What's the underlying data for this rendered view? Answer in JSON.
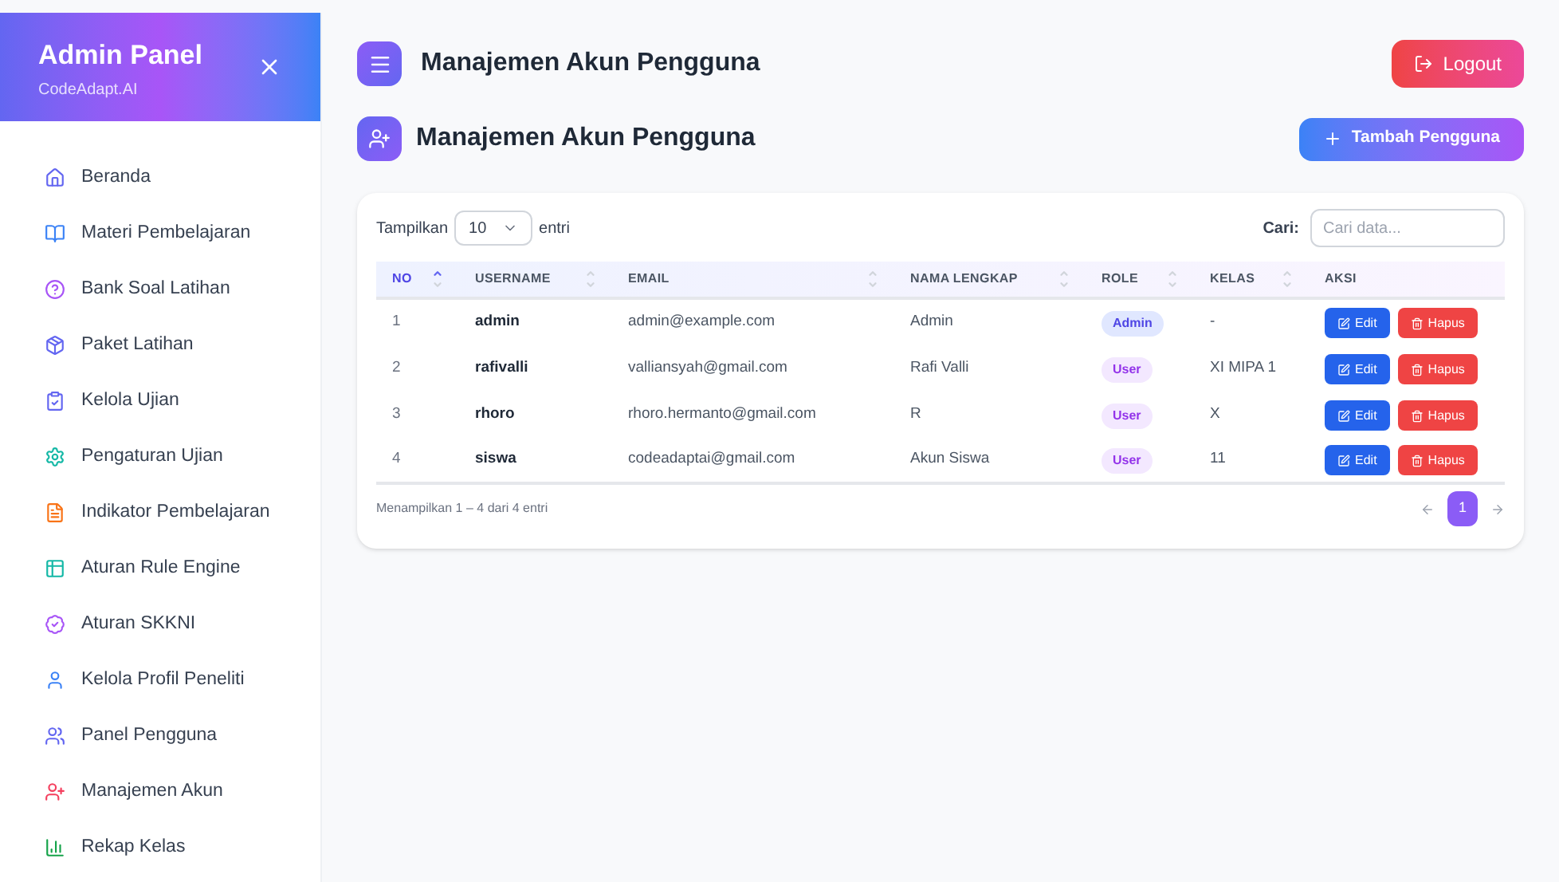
{
  "sidebar": {
    "title": "Admin Panel",
    "subtitle": "CodeAdapt.AI",
    "items": [
      {
        "label": "Beranda",
        "color": "#6366f1"
      },
      {
        "label": "Materi Pembelajaran",
        "color": "#3b82f6"
      },
      {
        "label": "Bank Soal Latihan",
        "color": "#a855f7"
      },
      {
        "label": "Paket Latihan",
        "color": "#6366f1"
      },
      {
        "label": "Kelola Ujian",
        "color": "#6366f1"
      },
      {
        "label": "Pengaturan Ujian",
        "color": "#14b8a6"
      },
      {
        "label": "Indikator Pembelajaran",
        "color": "#f97316"
      },
      {
        "label": "Aturan Rule Engine",
        "color": "#14b8a6"
      },
      {
        "label": "Aturan SKKNI",
        "color": "#a855f7"
      },
      {
        "label": "Kelola Profil Peneliti",
        "color": "#3b82f6"
      },
      {
        "label": "Panel Pengguna",
        "color": "#6366f1"
      },
      {
        "label": "Manajemen Akun",
        "color": "#f43f5e"
      },
      {
        "label": "Rekap Kelas",
        "color": "#16a34a"
      }
    ]
  },
  "header": {
    "title": "Manajemen Akun Pengguna",
    "logout": "Logout"
  },
  "page": {
    "title": "Manajemen Akun Pengguna",
    "add_button": "Tambah Pengguna"
  },
  "table_controls": {
    "show_label": "Tampilkan",
    "page_size": "10",
    "entries_label": "entri",
    "search_label": "Cari:",
    "search_placeholder": "Cari data..."
  },
  "table": {
    "columns": [
      {
        "label": "NO",
        "sorted": true
      },
      {
        "label": "USERNAME",
        "sorted": false
      },
      {
        "label": "EMAIL",
        "sorted": false
      },
      {
        "label": "NAMA LENGKAP",
        "sorted": false
      },
      {
        "label": "ROLE",
        "sorted": false
      },
      {
        "label": "KELAS",
        "sorted": false
      },
      {
        "label": "AKSI",
        "sorted": false
      }
    ],
    "rows": [
      {
        "no": "1",
        "username": "admin",
        "email": "admin@example.com",
        "name": "Admin",
        "role": "Admin",
        "kind": "admin",
        "kelas": "-",
        "edit": "Edit",
        "delete": "Hapus"
      },
      {
        "no": "2",
        "username": "rafivalli",
        "email": "valliansyah@gmail.com",
        "name": "Rafi Valli",
        "role": "User",
        "kind": "user",
        "kelas": "XI MIPA 1",
        "edit": "Edit",
        "delete": "Hapus"
      },
      {
        "no": "3",
        "username": "rhoro",
        "email": "rhoro.hermanto@gmail.com",
        "name": "R",
        "role": "User",
        "kind": "user",
        "kelas": "X",
        "edit": "Edit",
        "delete": "Hapus"
      },
      {
        "no": "4",
        "username": "siswa",
        "email": "codeadaptai@gmail.com",
        "name": "Akun Siswa",
        "role": "User",
        "kind": "user",
        "kelas": "11",
        "edit": "Edit",
        "delete": "Hapus"
      }
    ]
  },
  "footer": {
    "summary": "Menampilkan 1 – 4 dari 4 entri",
    "pages": [
      {
        "label": "1",
        "selected": true
      }
    ]
  }
}
